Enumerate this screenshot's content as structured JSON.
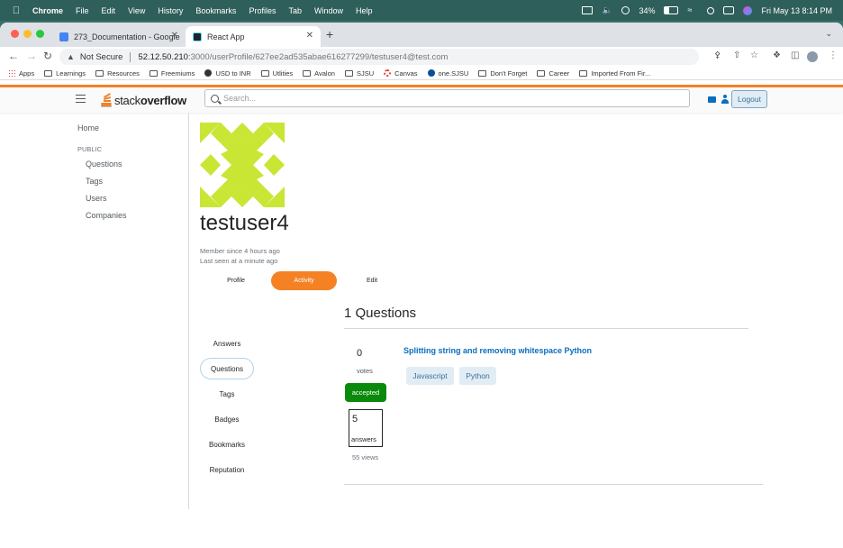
{
  "menubar": {
    "app": "Chrome",
    "items": [
      "File",
      "Edit",
      "View",
      "History",
      "Bookmarks",
      "Profiles",
      "Tab",
      "Window",
      "Help"
    ],
    "battery": "34%",
    "datetime": "Fri May 13  8:14 PM"
  },
  "tabs": [
    {
      "title": "273_Documentation - Google D",
      "active": false
    },
    {
      "title": "React App",
      "active": true
    }
  ],
  "address": {
    "security": "Not Secure",
    "host": "52.12.50.210",
    "path": ":3000/userProfile/627ee2ad535abae616277299/testuser4@test.com"
  },
  "bookmarks": [
    "Apps",
    "Learnings",
    "Resources",
    "Freemiums",
    "USD to INR",
    "Utlities",
    "Avalon",
    "SJSU",
    "Canvas",
    "one.SJSU",
    "Don't Forget",
    "Career",
    "Imported From Fir..."
  ],
  "header": {
    "logo_part1": "stack",
    "logo_part2": "overflow",
    "search_placeholder": "Search...",
    "logout_label": "Logout"
  },
  "sidebar": {
    "home": "Home",
    "section": "PUBLIC",
    "items": [
      "Questions",
      "Tags",
      "Users",
      "Companies"
    ]
  },
  "profile": {
    "username": "testuser4",
    "member_since": "Member since 4 hours ago",
    "last_seen": "Last seen at a minute ago",
    "avatar_color": "#c8e633",
    "tabs": [
      {
        "label": "Profile",
        "active": false
      },
      {
        "label": "Activity",
        "active": true
      },
      {
        "label": "Edit",
        "active": false
      }
    ]
  },
  "activity": {
    "subtabs": [
      {
        "label": "Answers",
        "active": false
      },
      {
        "label": "Questions",
        "active": true
      },
      {
        "label": "Tags",
        "active": false
      },
      {
        "label": "Badges",
        "active": false
      },
      {
        "label": "Bookmarks",
        "active": false
      },
      {
        "label": "Reputation",
        "active": false
      }
    ],
    "heading": "1 Questions",
    "question": {
      "votes": "0",
      "votes_label": "votes",
      "accepted_label": "accepted",
      "answers": "5",
      "answers_label": "answers",
      "views": "55 views",
      "title": "Splitting string and removing whitespace Python",
      "tags": [
        "Javascript",
        "Python"
      ]
    }
  }
}
